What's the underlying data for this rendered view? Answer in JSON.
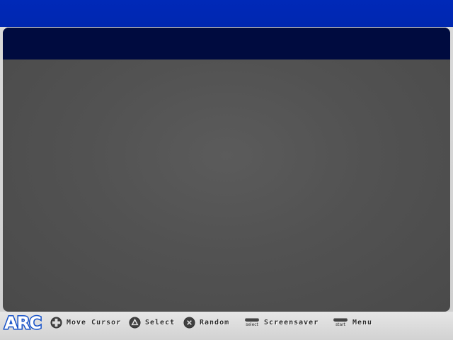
{
  "panel": {
    "header_color": "#000b3f",
    "body_color": "#525252"
  },
  "logo": {
    "text": "ARC"
  },
  "footer": {
    "hints": [
      {
        "icon": "dpad-icon",
        "label": "Move Cursor"
      },
      {
        "icon": "triangle-button-icon",
        "label": "Select"
      },
      {
        "icon": "cross-button-icon",
        "label": "Random"
      },
      {
        "icon": "select-button-icon",
        "small": "select",
        "label": "Screensaver"
      },
      {
        "icon": "start-button-icon",
        "small": "start",
        "label": "Menu"
      }
    ]
  },
  "colors": {
    "top_band": "#0029b8",
    "footer_bg": "#d8d8d8",
    "accent": "#1a63d6"
  }
}
